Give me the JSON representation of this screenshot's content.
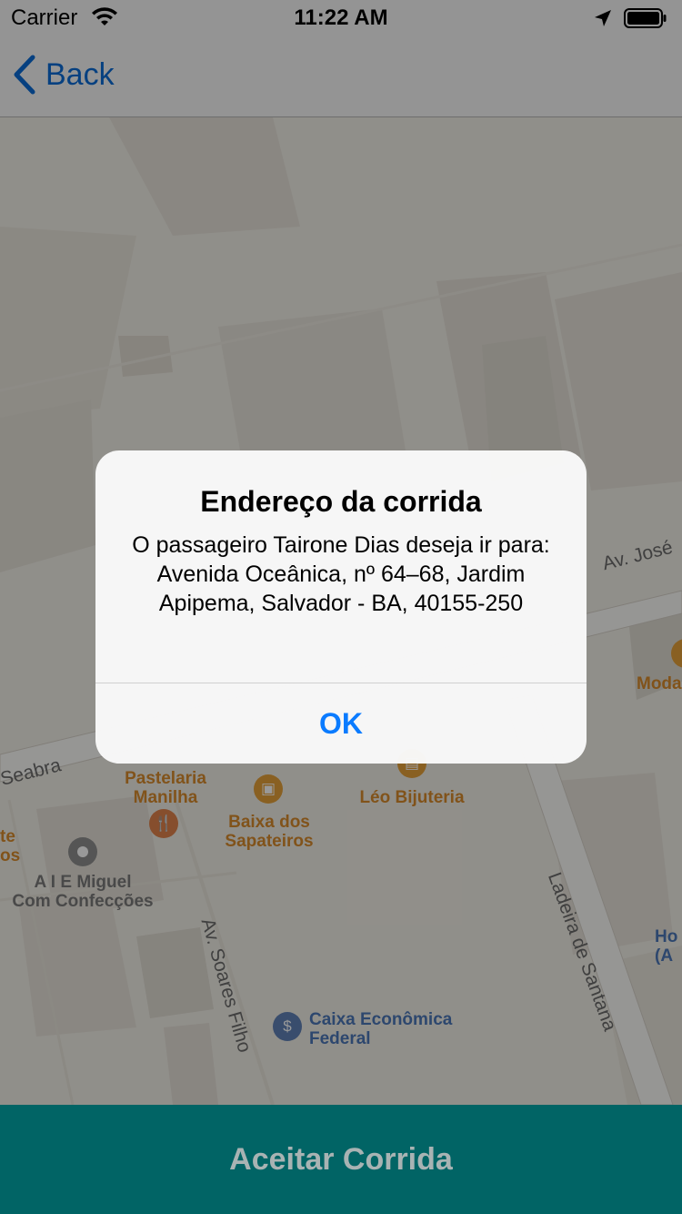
{
  "status_bar": {
    "carrier": "Carrier",
    "time": "11:22 AM",
    "icons": [
      "wifi-icon",
      "location-arrow-icon",
      "battery-icon"
    ]
  },
  "nav": {
    "back_label": "Back",
    "icon": "chevron-left-icon"
  },
  "map": {
    "streets": [
      "Av. José",
      "Seabra",
      "Av. Soares Filho",
      "Ladeira de Santana"
    ],
    "pois": [
      {
        "name": "Pastelaria\nManilha",
        "icon": "restaurant-icon"
      },
      {
        "name": "Baixa dos\nSapateiros",
        "icon": "shopping-bag-icon"
      },
      {
        "name": "Léo Bijuteria",
        "icon": "store-icon"
      },
      {
        "name": "A I E Miguel\nCom Confecções",
        "icon": "dot-icon"
      },
      {
        "name": "Caixa Econômica\nFederal",
        "icon": "bank-icon"
      },
      {
        "name": "Moda",
        "icon": "store-icon"
      },
      {
        "name": "te\nos"
      },
      {
        "name": "Ho\n(A"
      }
    ]
  },
  "alert": {
    "title": "Endereço da corrida",
    "message": "O passageiro Tairone Dias deseja ir para: Avenida Oceânica, nº 64–68, Jardim Apipema, Salvador - BA, 40155-250",
    "ok_label": "OK"
  },
  "accept_button": {
    "label": "Aceitar Corrida"
  },
  "colors": {
    "accent": "#0a7bff",
    "accept_bg": "#016465",
    "poi_orange": "#d88a2c"
  }
}
